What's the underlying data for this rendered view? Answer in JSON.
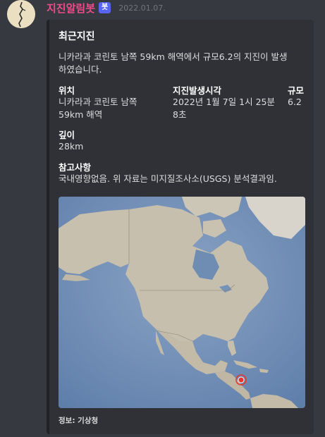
{
  "message": {
    "username": "지진알림봇",
    "bot_badge": "봇",
    "timestamp": "2022.01.07."
  },
  "embed": {
    "title": "최근지진",
    "description": "니카라과 코린토 남쪽 59km 해역에서 규모6.2의 지진이 발생하였습니다.",
    "fields": [
      {
        "name": "위치",
        "value": "니카라과 코린토 남쪽 59km 해역"
      },
      {
        "name": "지진발생시각",
        "value": "2022년 1월 7일 1시 25분 8초"
      },
      {
        "name": "규모",
        "value": "6.2"
      },
      {
        "name": "깊이",
        "value": "28km"
      },
      {
        "name": "참고사항",
        "value": "국내영향없음. 위 자료는 미지질조사소(USGS) 분석결과임."
      }
    ],
    "footer": "정보: 기상청"
  },
  "colors": {
    "background": "#36393f",
    "embed_background": "#2f3136",
    "username": "#f04a8c",
    "bot_badge": "#5865f2",
    "ocean": "#6f8cb3",
    "land": "#c6bfae",
    "epicenter": "#e8342c"
  },
  "icons": {
    "avatar": "bot-avatar-icon",
    "epicenter": "epicenter-marker-icon"
  }
}
